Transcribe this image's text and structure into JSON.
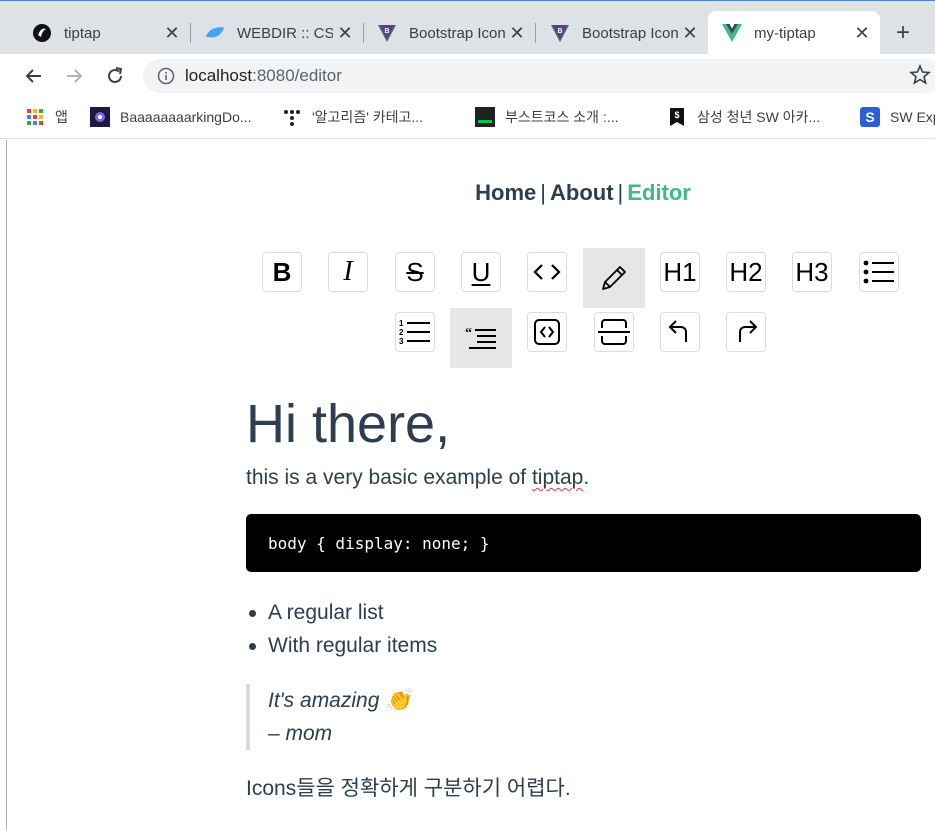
{
  "browser": {
    "tabs": [
      {
        "title": "tiptap",
        "icon": "tiptap-favicon",
        "close": "✕"
      },
      {
        "title": "WEBDIR :: CSS",
        "icon": "webdir-favicon",
        "close": "✕"
      },
      {
        "title": "Bootstrap Icons",
        "icon": "bootstrap-favicon",
        "close": "✕"
      },
      {
        "title": "Bootstrap Icons",
        "icon": "bootstrap-favicon",
        "close": "✕"
      },
      {
        "title": "my-tiptap",
        "icon": "vue-favicon",
        "close": "✕",
        "active": true
      }
    ],
    "new_tab": "+",
    "url_host": "localhost",
    "url_path": ":8080/editor",
    "bookmarks": [
      {
        "label": "앱",
        "icon": "apps-grid-icon"
      },
      {
        "label": "BaaaaaaaarkingDo...",
        "icon": "baarking-favicon"
      },
      {
        "label": "'알고리즘' 카테고...",
        "icon": "dots-favicon"
      },
      {
        "label": "부스트코스 소개 :...",
        "icon": "boostcourse-favicon"
      },
      {
        "label": "삼성 청년 SW 아카...",
        "icon": "ssafy-favicon"
      },
      {
        "label": "SW Exp",
        "icon": "swexpert-favicon"
      }
    ]
  },
  "nav": {
    "home": "Home",
    "about": "About",
    "editor": "Editor",
    "separator": "|"
  },
  "menubar": {
    "buttons": [
      {
        "name": "bold",
        "label": "B"
      },
      {
        "name": "italic",
        "label": "I"
      },
      {
        "name": "strike",
        "label": "S"
      },
      {
        "name": "underline",
        "label": "U"
      },
      {
        "name": "code",
        "label": "<>"
      },
      {
        "name": "paragraph",
        "label": "pencil",
        "active": true
      },
      {
        "name": "h1",
        "label": "H1"
      },
      {
        "name": "h2",
        "label": "H2"
      },
      {
        "name": "h3",
        "label": "H3"
      },
      {
        "name": "bullet-list",
        "label": "list"
      },
      {
        "name": "ordered-list",
        "label": "list-ol"
      },
      {
        "name": "blockquote",
        "label": "quote",
        "active": true
      },
      {
        "name": "code-block",
        "label": "code-square"
      },
      {
        "name": "horizontal-rule",
        "label": "hr"
      },
      {
        "name": "undo",
        "label": "undo"
      },
      {
        "name": "redo",
        "label": "redo"
      }
    ]
  },
  "content": {
    "heading": "Hi there,",
    "intro_pre": "this is a very basic example of ",
    "intro_link": "tiptap",
    "intro_post": ".",
    "code": "body { display: none; }",
    "list": [
      "A regular list",
      "With regular items"
    ],
    "quote_line1": "It's amazing 👏",
    "quote_line2": "– mom",
    "footer_text": "Icons들을 정확하게 구분하기 어렵다."
  },
  "colors": {
    "accent": "#42b983",
    "text": "#2c3e50",
    "active_bg": "#e6e6e6"
  }
}
